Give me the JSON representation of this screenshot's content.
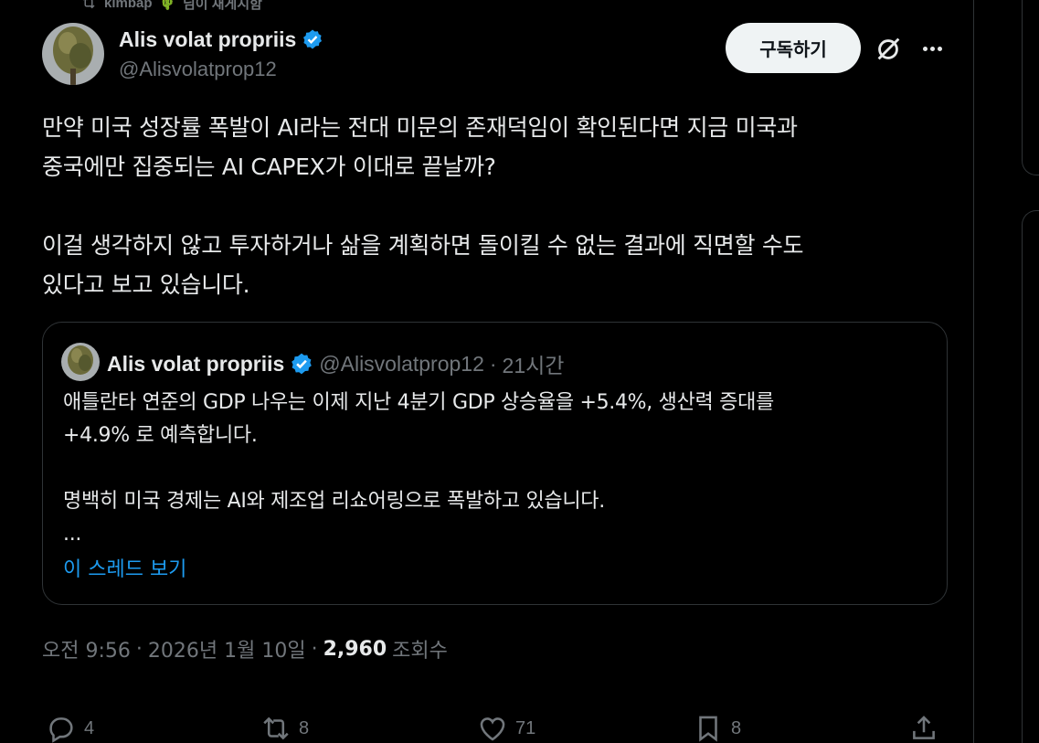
{
  "repost_bar": {
    "user": "kimbap",
    "emoji_name": "cactus-emoji",
    "text": "님이 재게시함"
  },
  "author": {
    "name": "Alis volat propriis",
    "handle": "@Alisvolatprop12"
  },
  "buttons": {
    "subscribe": "구독하기"
  },
  "tweet_text": "만약 미국 성장률 폭발이 AI라는 전대 미문의 존재덕임이 확인된다면 지금 미국과\n중국에만 집중되는 AI CAPEX가 이대로 끝날까?\n\n이걸 생각하지 않고 투자하거나 삶을 계획하면 돌이킬 수 없는 결과에 직면할 수도\n있다고 보고 있습니다.",
  "quote": {
    "name": "Alis volat propriis",
    "handle": "@Alisvolatprop12",
    "sep": "·",
    "time": "21시간",
    "text": "애틀란타 연준의 GDP 나우는 이제 지난 4분기 GDP 상승율을 +5.4%, 생산력 증대를\n+4.9% 로 예측합니다.\n\n명백히 미국 경제는 AI와 제조업 리쇼어링으로 폭발하고 있습니다.\n...",
    "show_thread": "이 스레드 보기"
  },
  "meta": {
    "time": "오전 9:56",
    "sep": "·",
    "date": "2026년 1월 10일",
    "sep2": "·",
    "views": "2,960",
    "views_label": "조회수"
  },
  "actions": {
    "replies": "4",
    "reposts": "8",
    "likes": "71",
    "bookmarks": "8"
  },
  "colors": {
    "background": "#000000",
    "text": "#e7e9ea",
    "muted": "#71767b",
    "accent": "#1d9bf0",
    "border": "#2f3336"
  }
}
